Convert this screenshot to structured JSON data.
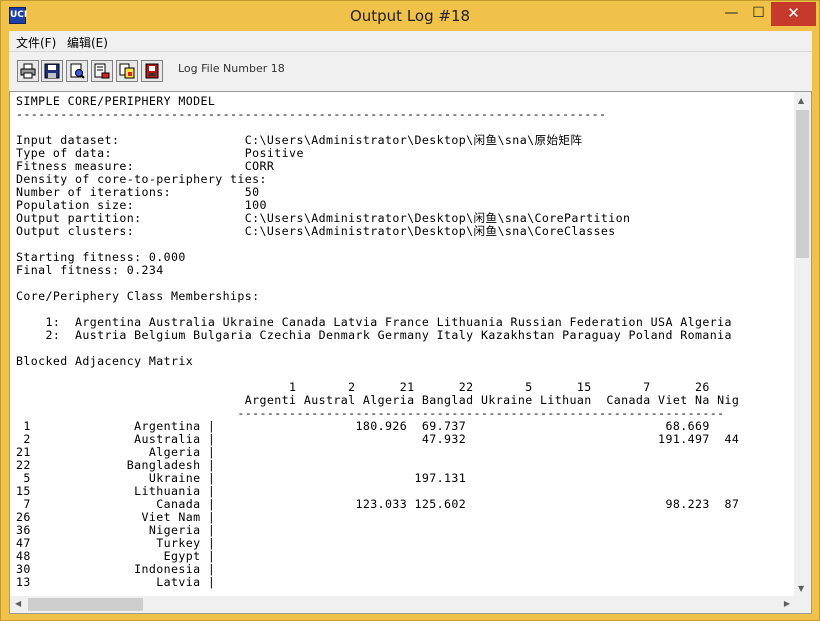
{
  "window": {
    "title": "Output Log #18",
    "controls": {
      "minimize": "—",
      "maximize": "☐",
      "close": "✕"
    }
  },
  "menu": {
    "file": "文件(F)",
    "edit": "编辑(E)"
  },
  "toolbar": {
    "label": "Log File Number 18",
    "buttons": [
      "print-icon",
      "save-icon",
      "find-icon",
      "export-icon",
      "copy-icon",
      "exit-icon"
    ]
  },
  "log": {
    "lines": [
      "SIMPLE CORE/PERIPHERY MODEL",
      "--------------------------------------------------------------------------------",
      "",
      "Input dataset:                 C:\\Users\\Administrator\\Desktop\\闲鱼\\sna\\原始矩阵",
      "Type of data:                  Positive",
      "Fitness measure:               CORR",
      "Density of core-to-periphery ties:",
      "Number of iterations:          50",
      "Population size:               100",
      "Output partition:              C:\\Users\\Administrator\\Desktop\\闲鱼\\sna\\CorePartition",
      "Output clusters:               C:\\Users\\Administrator\\Desktop\\闲鱼\\sna\\CoreClasses",
      "",
      "Starting fitness: 0.000",
      "Final fitness: 0.234",
      "",
      "Core/Periphery Class Memberships:",
      "",
      "    1:  Argentina Australia Ukraine Canada Latvia France Lithuania Russian Federation USA Algeria",
      "    2:  Austria Belgium Bulgaria Czechia Denmark Germany Italy Kazakhstan Paraguay Poland Romania",
      "",
      "Blocked Adjacency Matrix",
      "",
      "                                     1       2      21      22       5      15       7      26",
      "                               Argenti Austral Algeria Banglad Ukraine Lithuan  Canada Viet Na Nig",
      "                              ------------------------------------------------------------------",
      " 1              Argentina |                   180.926  69.737                           68.669",
      " 2              Australia |                            47.932                          191.497  44",
      "21                Algeria |",
      "22             Bangladesh |",
      " 5                Ukraine |                           197.131",
      "15              Lithuania |",
      " 7                 Canada |                   123.033 125.602                           98.223  87",
      "26               Viet Nam |",
      "36                Nigeria |",
      "47                 Turkey |",
      "48                  Egypt |",
      "30              Indonesia |",
      "13                 Latvia |"
    ]
  }
}
